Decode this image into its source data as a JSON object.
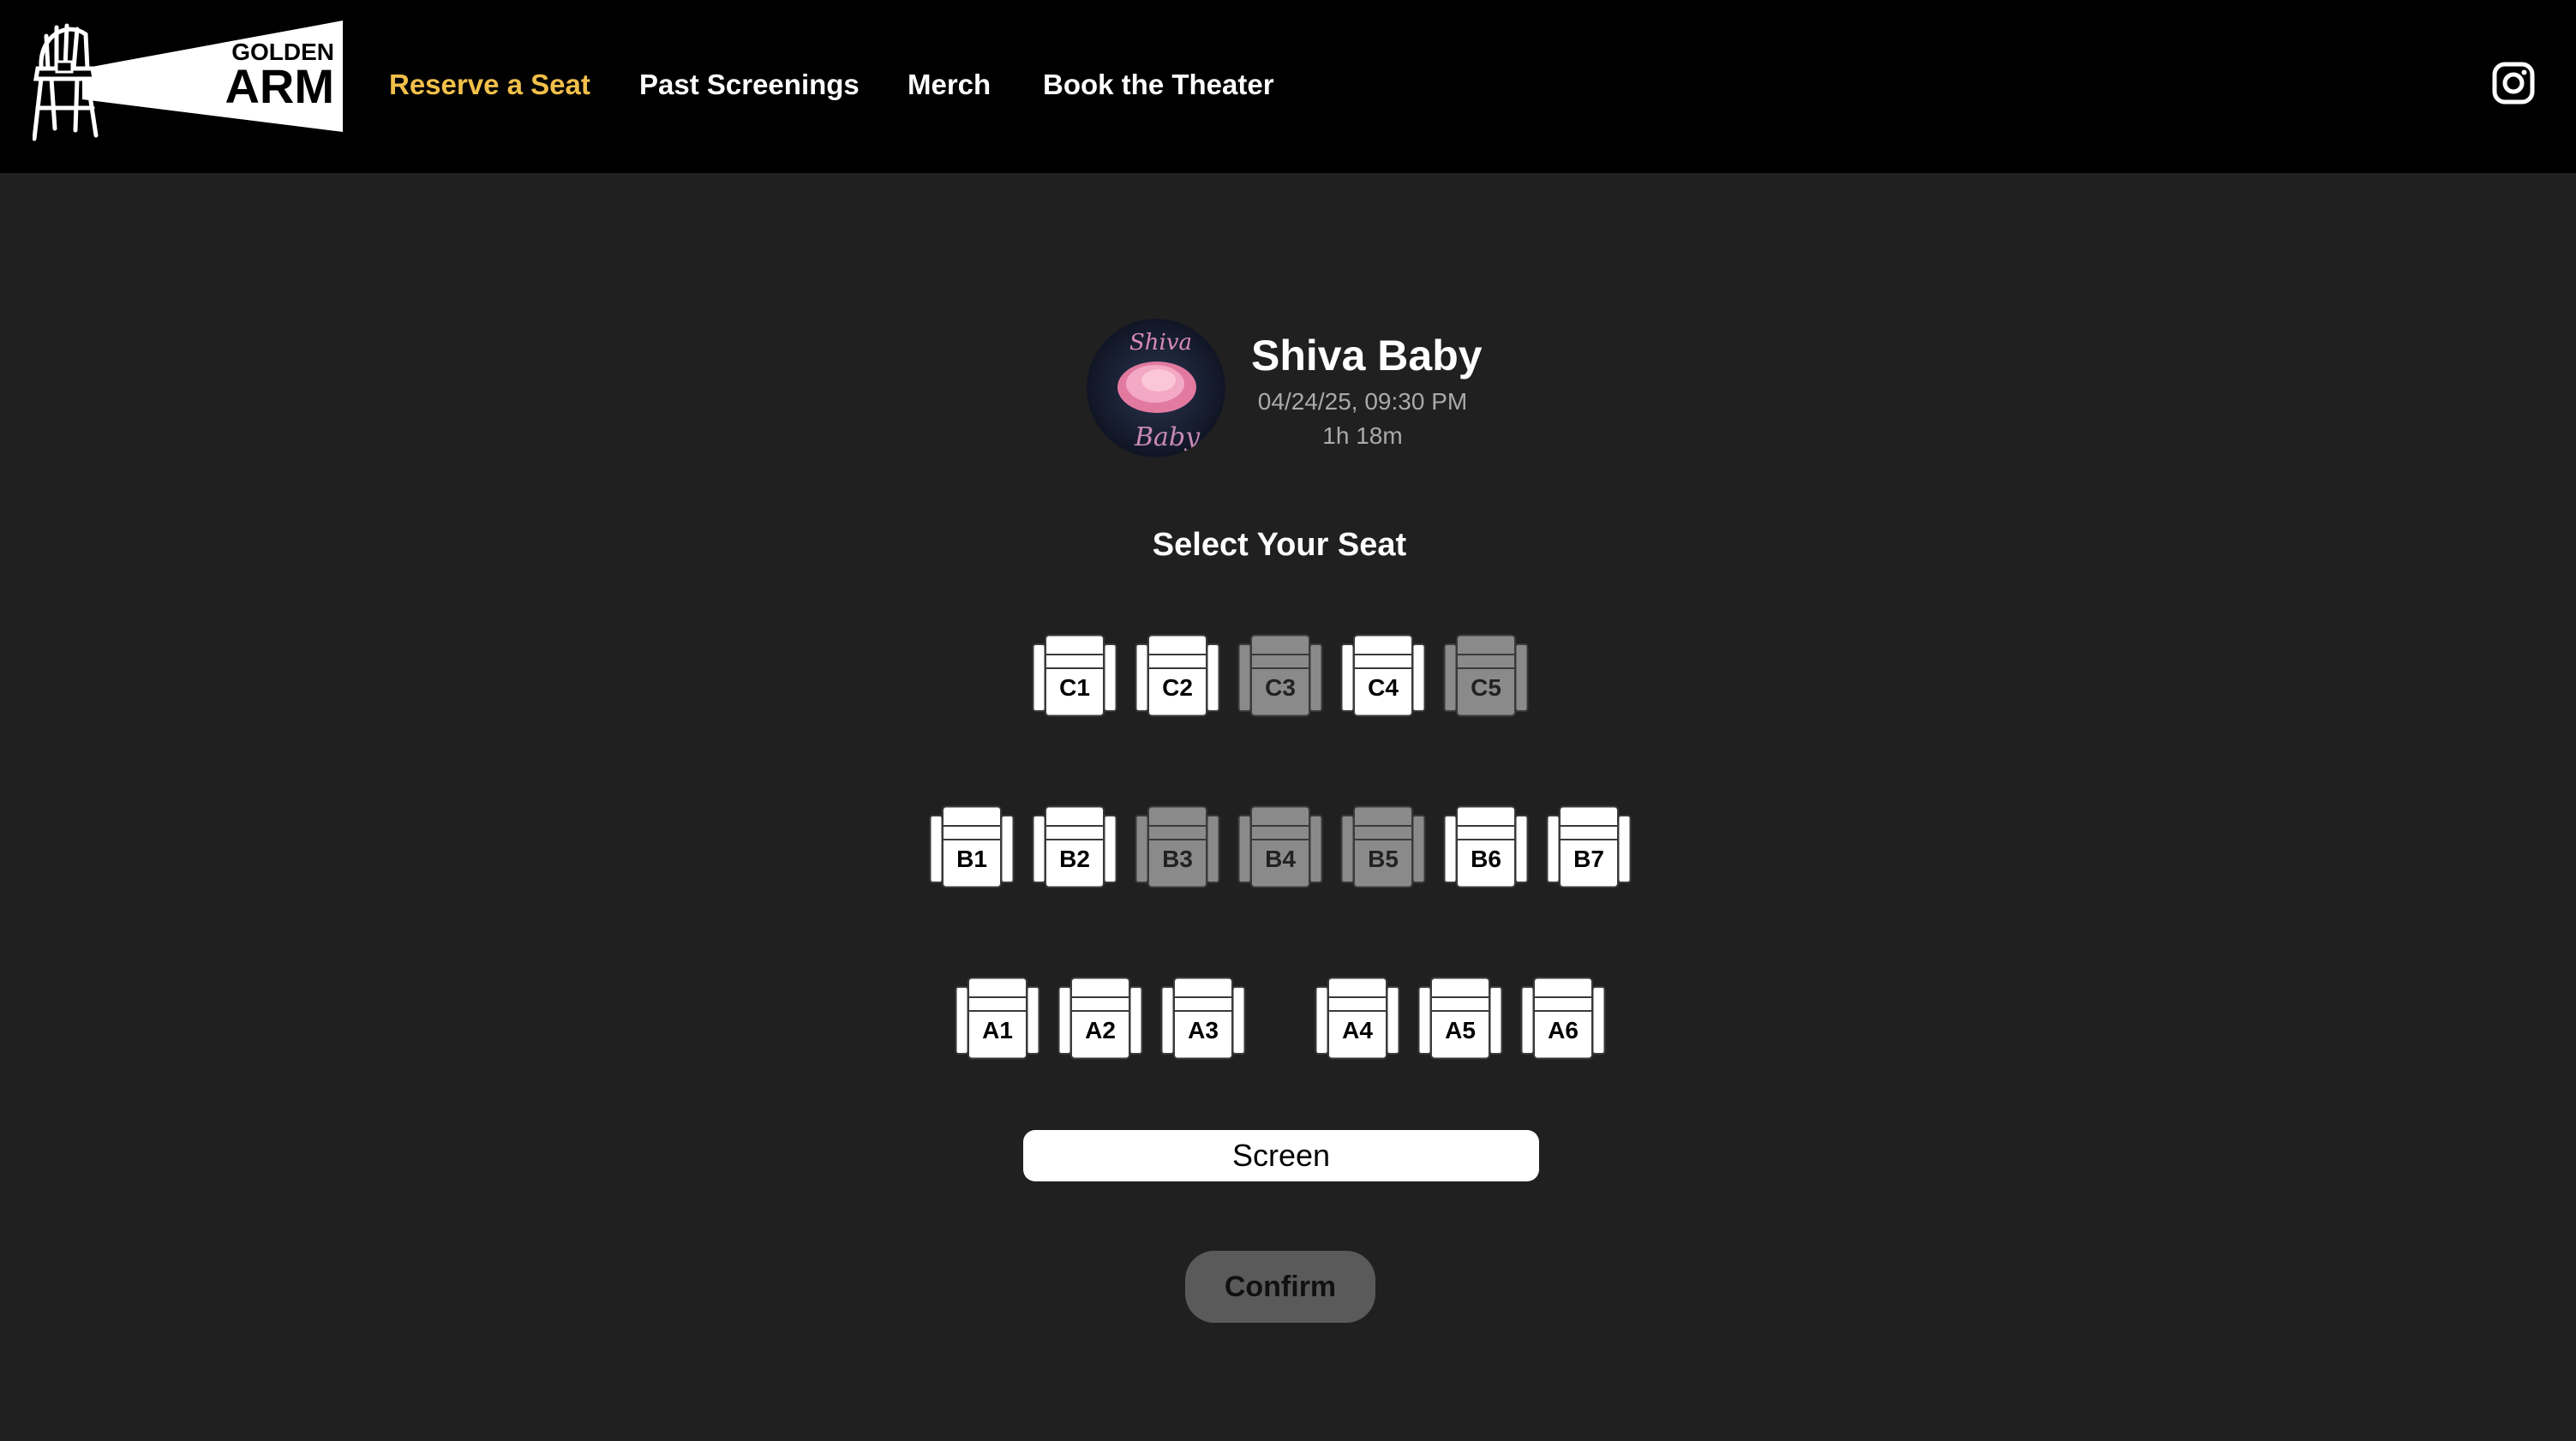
{
  "header": {
    "logo": {
      "line1": "GOLDEN",
      "line2": "ARM"
    },
    "nav": [
      {
        "label": "Reserve a Seat",
        "active": true
      },
      {
        "label": "Past Screenings",
        "active": false
      },
      {
        "label": "Merch",
        "active": false
      },
      {
        "label": "Book the Theater",
        "active": false
      }
    ],
    "social_icon": "instagram-icon"
  },
  "movie": {
    "title": "Shiva Baby",
    "datetime": "04/24/25, 09:30 PM",
    "runtime": "1h 18m",
    "poster_text_top": "Shiva",
    "poster_text_bottom": "Baby"
  },
  "seating": {
    "title": "Select Your Seat",
    "rows": [
      {
        "row": "C",
        "seats": [
          {
            "label": "C1",
            "available": true
          },
          {
            "label": "C2",
            "available": true
          },
          {
            "label": "C3",
            "available": false
          },
          {
            "label": "C4",
            "available": true
          },
          {
            "label": "C5",
            "available": false
          }
        ]
      },
      {
        "row": "B",
        "seats": [
          {
            "label": "B1",
            "available": true
          },
          {
            "label": "B2",
            "available": true
          },
          {
            "label": "B3",
            "available": false
          },
          {
            "label": "B4",
            "available": false
          },
          {
            "label": "B5",
            "available": false
          },
          {
            "label": "B6",
            "available": true
          },
          {
            "label": "B7",
            "available": true
          }
        ]
      },
      {
        "row": "A",
        "seats": [
          {
            "label": "A1",
            "available": true
          },
          {
            "label": "A2",
            "available": true
          },
          {
            "label": "A3",
            "available": true
          },
          {
            "label": "A4",
            "available": true
          },
          {
            "label": "A5",
            "available": true
          },
          {
            "label": "A6",
            "available": true
          }
        ]
      }
    ],
    "screen_label": "Screen",
    "confirm_label": "Confirm"
  },
  "colors": {
    "background": "#202020",
    "header": "#000000",
    "accent": "#f2c04a",
    "seat_available": "#ffffff",
    "seat_taken": "#8a8a8a",
    "confirm_button": "#5a5a5a"
  }
}
